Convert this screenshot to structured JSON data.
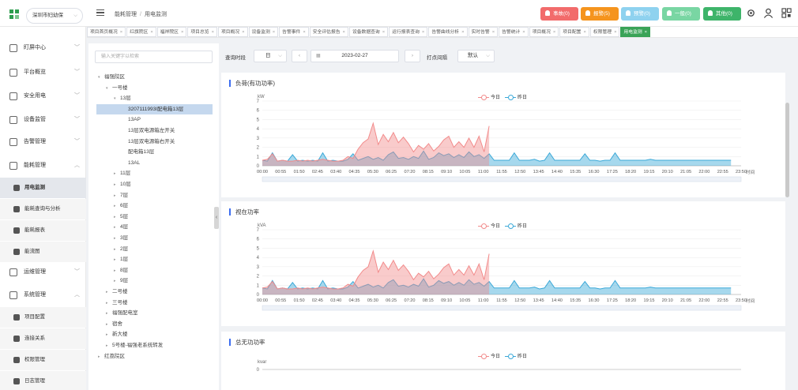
{
  "header": {
    "site": "深圳市妇幼保",
    "breadcrumb": [
      "能耗管理",
      "用电监测"
    ],
    "alarms": [
      {
        "label": "事故(0)",
        "color": "#f26b6b"
      },
      {
        "label": "报警(5)",
        "color": "#f5941d"
      },
      {
        "label": "预警(0)",
        "color": "#8fd2ef"
      },
      {
        "label": "一般(0)",
        "color": "#79d6a3"
      },
      {
        "label": "其他(0)",
        "color": "#3eb46a"
      }
    ]
  },
  "sidebar": {
    "items": [
      {
        "label": "盯屏中心",
        "chev": "﹀"
      },
      {
        "label": "平台概览",
        "chev": "﹀"
      },
      {
        "label": "安全用电",
        "chev": "﹀"
      },
      {
        "label": "设备监管",
        "chev": "﹀"
      },
      {
        "label": "告警管理",
        "chev": "﹀"
      },
      {
        "label": "能耗管理",
        "chev": "︿"
      }
    ],
    "energy_sub": [
      "用电监测",
      "能耗查询与分析",
      "能耗报表",
      "能流图"
    ],
    "items2": [
      {
        "label": "运维管理",
        "chev": "﹀"
      },
      {
        "label": "系统管理",
        "chev": "︿"
      }
    ],
    "system_sub": [
      "项目配置",
      "连接关系",
      "权限管理",
      "日志管理"
    ]
  },
  "tabs": [
    "项目首页概况",
    "红旗院区",
    "福祥院区",
    "项目总览",
    "项目概况",
    "设备监测",
    "告警事件",
    "安全评估报告",
    "设备数据查询",
    "运行报表查询",
    "告警曲线分析",
    "实时告警",
    "告警统计",
    "项目概况",
    "项目配置",
    "权限管理",
    "用电监测"
  ],
  "tree": {
    "search_placeholder": "输入关键字以检索",
    "nodes": [
      {
        "label": "福强院区",
        "level": 0,
        "caret": "▾"
      },
      {
        "label": "一号楼",
        "level": 1,
        "caret": "▾"
      },
      {
        "label": "13层",
        "level": 2,
        "caret": "▾"
      },
      {
        "label": "3207111993I配电箱13层",
        "level": 3,
        "caret": "",
        "selected": true
      },
      {
        "label": "13AP",
        "level": 3,
        "caret": ""
      },
      {
        "label": "13层双电源箱左开关",
        "level": 3,
        "caret": ""
      },
      {
        "label": "13层双电源箱右开关",
        "level": 3,
        "caret": ""
      },
      {
        "label": "配电箱13层",
        "level": 3,
        "caret": ""
      },
      {
        "label": "13AL",
        "level": 3,
        "caret": ""
      },
      {
        "label": "11层",
        "level": 2,
        "caret": "▸"
      },
      {
        "label": "10层",
        "level": 2,
        "caret": "▸"
      },
      {
        "label": "7层",
        "level": 2,
        "caret": "▸"
      },
      {
        "label": "6层",
        "level": 2,
        "caret": "▸"
      },
      {
        "label": "5层",
        "level": 2,
        "caret": "▸"
      },
      {
        "label": "4层",
        "level": 2,
        "caret": "▸"
      },
      {
        "label": "3层",
        "level": 2,
        "caret": "▸"
      },
      {
        "label": "2层",
        "level": 2,
        "caret": "▸"
      },
      {
        "label": "1层",
        "level": 2,
        "caret": "▸"
      },
      {
        "label": "8层",
        "level": 2,
        "caret": "▸"
      },
      {
        "label": "9层",
        "level": 2,
        "caret": "▸"
      },
      {
        "label": "二号楼",
        "level": 1,
        "caret": "▸"
      },
      {
        "label": "三号楼",
        "level": 1,
        "caret": "▸"
      },
      {
        "label": "福强配电室",
        "level": 1,
        "caret": "▸"
      },
      {
        "label": "宿舍",
        "level": 1,
        "caret": "▸"
      },
      {
        "label": "新大楼",
        "level": 1,
        "caret": "▸"
      },
      {
        "label": "5号楼-福强老系统转发",
        "level": 1,
        "caret": "▸"
      },
      {
        "label": "红荔院区",
        "level": 0,
        "caret": "▸"
      }
    ]
  },
  "filters": {
    "query_label": "查询时段",
    "period": "日",
    "date": "2023-02-27",
    "interval_label": "打点间隔",
    "interval": "默认"
  },
  "colors": {
    "today": "#f28b8b",
    "yesterday": "#3aa8d8",
    "accent": "#3aa357"
  },
  "chart_data": [
    {
      "type": "line",
      "title": "负荷(有功功率)",
      "ylabel": "kW",
      "xlabel": "时间",
      "ylim": [
        0,
        7
      ],
      "yticks": [
        0,
        1,
        2,
        3,
        4,
        5,
        6,
        7
      ],
      "xticks": [
        "00:00",
        "00:55",
        "01:50",
        "02:45",
        "03:40",
        "04:35",
        "05:30",
        "06:25",
        "07:20",
        "08:15",
        "09:10",
        "10:05",
        "11:00",
        "11:55",
        "12:50",
        "13:45",
        "14:40",
        "15:35",
        "16:30",
        "17:25",
        "18:20",
        "19:15",
        "20:10",
        "21:05",
        "22:00",
        "22:55",
        "23:50"
      ],
      "series": [
        {
          "name": "今日",
          "values": [
            0.6,
            0.7,
            1.3,
            0.5,
            0.6,
            0.5,
            0.5,
            0.6,
            0.5,
            0.6,
            0.5,
            0.6,
            0.7,
            0.6,
            0.5,
            0.5,
            0.6,
            1.0,
            0.8,
            1.8,
            2.5,
            2.9,
            4.6,
            2.3,
            3.4,
            2.6,
            3.6,
            2.5,
            3.1,
            2.4,
            1.5,
            2.2,
            1.8,
            2.4,
            1.6,
            2.1,
            2.8,
            3.2,
            2.0,
            2.6,
            2.0,
            3.0,
            2.0,
            3.2,
            1.5,
            4.3
          ]
        },
        {
          "name": "昨日",
          "values": [
            0.6,
            0.5,
            1.4,
            0.5,
            0.6,
            0.5,
            1.2,
            0.5,
            0.6,
            0.5,
            0.6,
            0.5,
            1.4,
            0.5,
            0.6,
            0.5,
            0.5,
            0.7,
            1.3,
            0.6,
            0.8,
            1.0,
            0.7,
            0.9,
            0.6,
            1.2,
            1.5,
            0.8,
            0.9,
            0.7,
            1.0,
            0.8,
            1.6,
            0.7,
            0.9,
            1.4,
            1.1,
            1.3,
            0.9,
            1.2,
            0.9,
            1.5,
            1.0,
            1.2,
            0.8,
            1.3,
            0.6,
            0.6,
            0.6,
            0.6,
            1.4,
            0.6,
            0.6,
            0.6,
            0.7,
            0.5,
            0.6,
            1.4,
            0.6,
            0.6,
            0.6,
            0.6,
            0.6,
            0.6,
            1.3,
            0.6,
            0.6,
            0.5,
            0.6,
            0.6,
            1.4,
            0.6,
            0.6,
            0.6,
            0.6,
            0.6,
            0.6,
            0.7,
            0.6,
            0.6,
            0.6,
            0.6,
            0.6,
            0.6,
            0.6,
            0.6,
            0.6,
            0.6,
            0.6,
            0.6,
            0.6,
            0.6,
            0.6,
            0.6
          ]
        }
      ]
    },
    {
      "type": "line",
      "title": "视在功率",
      "ylabel": "kVA",
      "xlabel": "时间",
      "ylim": [
        0,
        7
      ],
      "yticks": [
        0,
        1,
        2,
        3,
        4,
        5,
        6,
        7
      ],
      "xticks": [
        "00:00",
        "00:55",
        "01:50",
        "02:45",
        "03:40",
        "04:35",
        "05:30",
        "06:25",
        "07:20",
        "08:15",
        "09:10",
        "10:05",
        "11:00",
        "11:55",
        "12:50",
        "13:45",
        "14:40",
        "15:35",
        "16:30",
        "17:25",
        "18:20",
        "19:15",
        "20:10",
        "21:05",
        "22:00",
        "22:55",
        "23:50"
      ],
      "series": [
        {
          "name": "今日",
          "values": [
            0.7,
            0.8,
            1.4,
            0.6,
            0.7,
            0.6,
            0.6,
            0.7,
            0.6,
            0.7,
            0.6,
            0.7,
            0.8,
            0.7,
            0.6,
            0.6,
            0.7,
            1.1,
            0.9,
            1.9,
            2.6,
            3.0,
            4.7,
            2.4,
            3.5,
            2.7,
            3.7,
            2.6,
            3.2,
            2.5,
            1.6,
            2.3,
            1.9,
            2.5,
            1.7,
            2.2,
            2.9,
            3.3,
            2.1,
            2.7,
            2.1,
            3.1,
            2.1,
            3.3,
            1.6,
            4.4
          ]
        },
        {
          "name": "昨日",
          "values": [
            0.7,
            0.6,
            1.5,
            0.6,
            0.7,
            0.6,
            1.3,
            0.6,
            0.7,
            0.6,
            0.7,
            0.6,
            1.5,
            0.6,
            0.7,
            0.6,
            0.6,
            0.8,
            1.4,
            0.7,
            0.9,
            1.1,
            0.8,
            1.0,
            0.7,
            1.3,
            1.6,
            0.9,
            1.0,
            0.8,
            1.1,
            0.9,
            1.7,
            0.8,
            1.0,
            1.5,
            1.2,
            1.4,
            1.0,
            1.3,
            1.0,
            1.6,
            1.1,
            1.3,
            0.9,
            1.4,
            0.7,
            0.7,
            0.7,
            0.7,
            1.5,
            0.7,
            0.7,
            0.7,
            0.8,
            0.6,
            0.7,
            1.5,
            0.7,
            0.7,
            0.7,
            0.7,
            0.7,
            0.7,
            1.4,
            0.7,
            0.7,
            0.6,
            0.7,
            0.7,
            1.5,
            0.7,
            0.7,
            0.7,
            0.7,
            0.7,
            0.7,
            0.8,
            0.7,
            0.7,
            0.7,
            0.7,
            0.7,
            0.7,
            0.7,
            0.7,
            0.7,
            0.7,
            0.7,
            0.7,
            0.7,
            0.7,
            0.7,
            0.7
          ]
        }
      ]
    },
    {
      "type": "line",
      "title": "总无功功率",
      "ylabel": "kvar",
      "xlabel": "",
      "ylim": [
        0,
        1
      ],
      "yticks": [
        0
      ],
      "xticks": [],
      "series": [
        {
          "name": "今日",
          "values": []
        },
        {
          "name": "昨日",
          "values": []
        }
      ]
    }
  ]
}
